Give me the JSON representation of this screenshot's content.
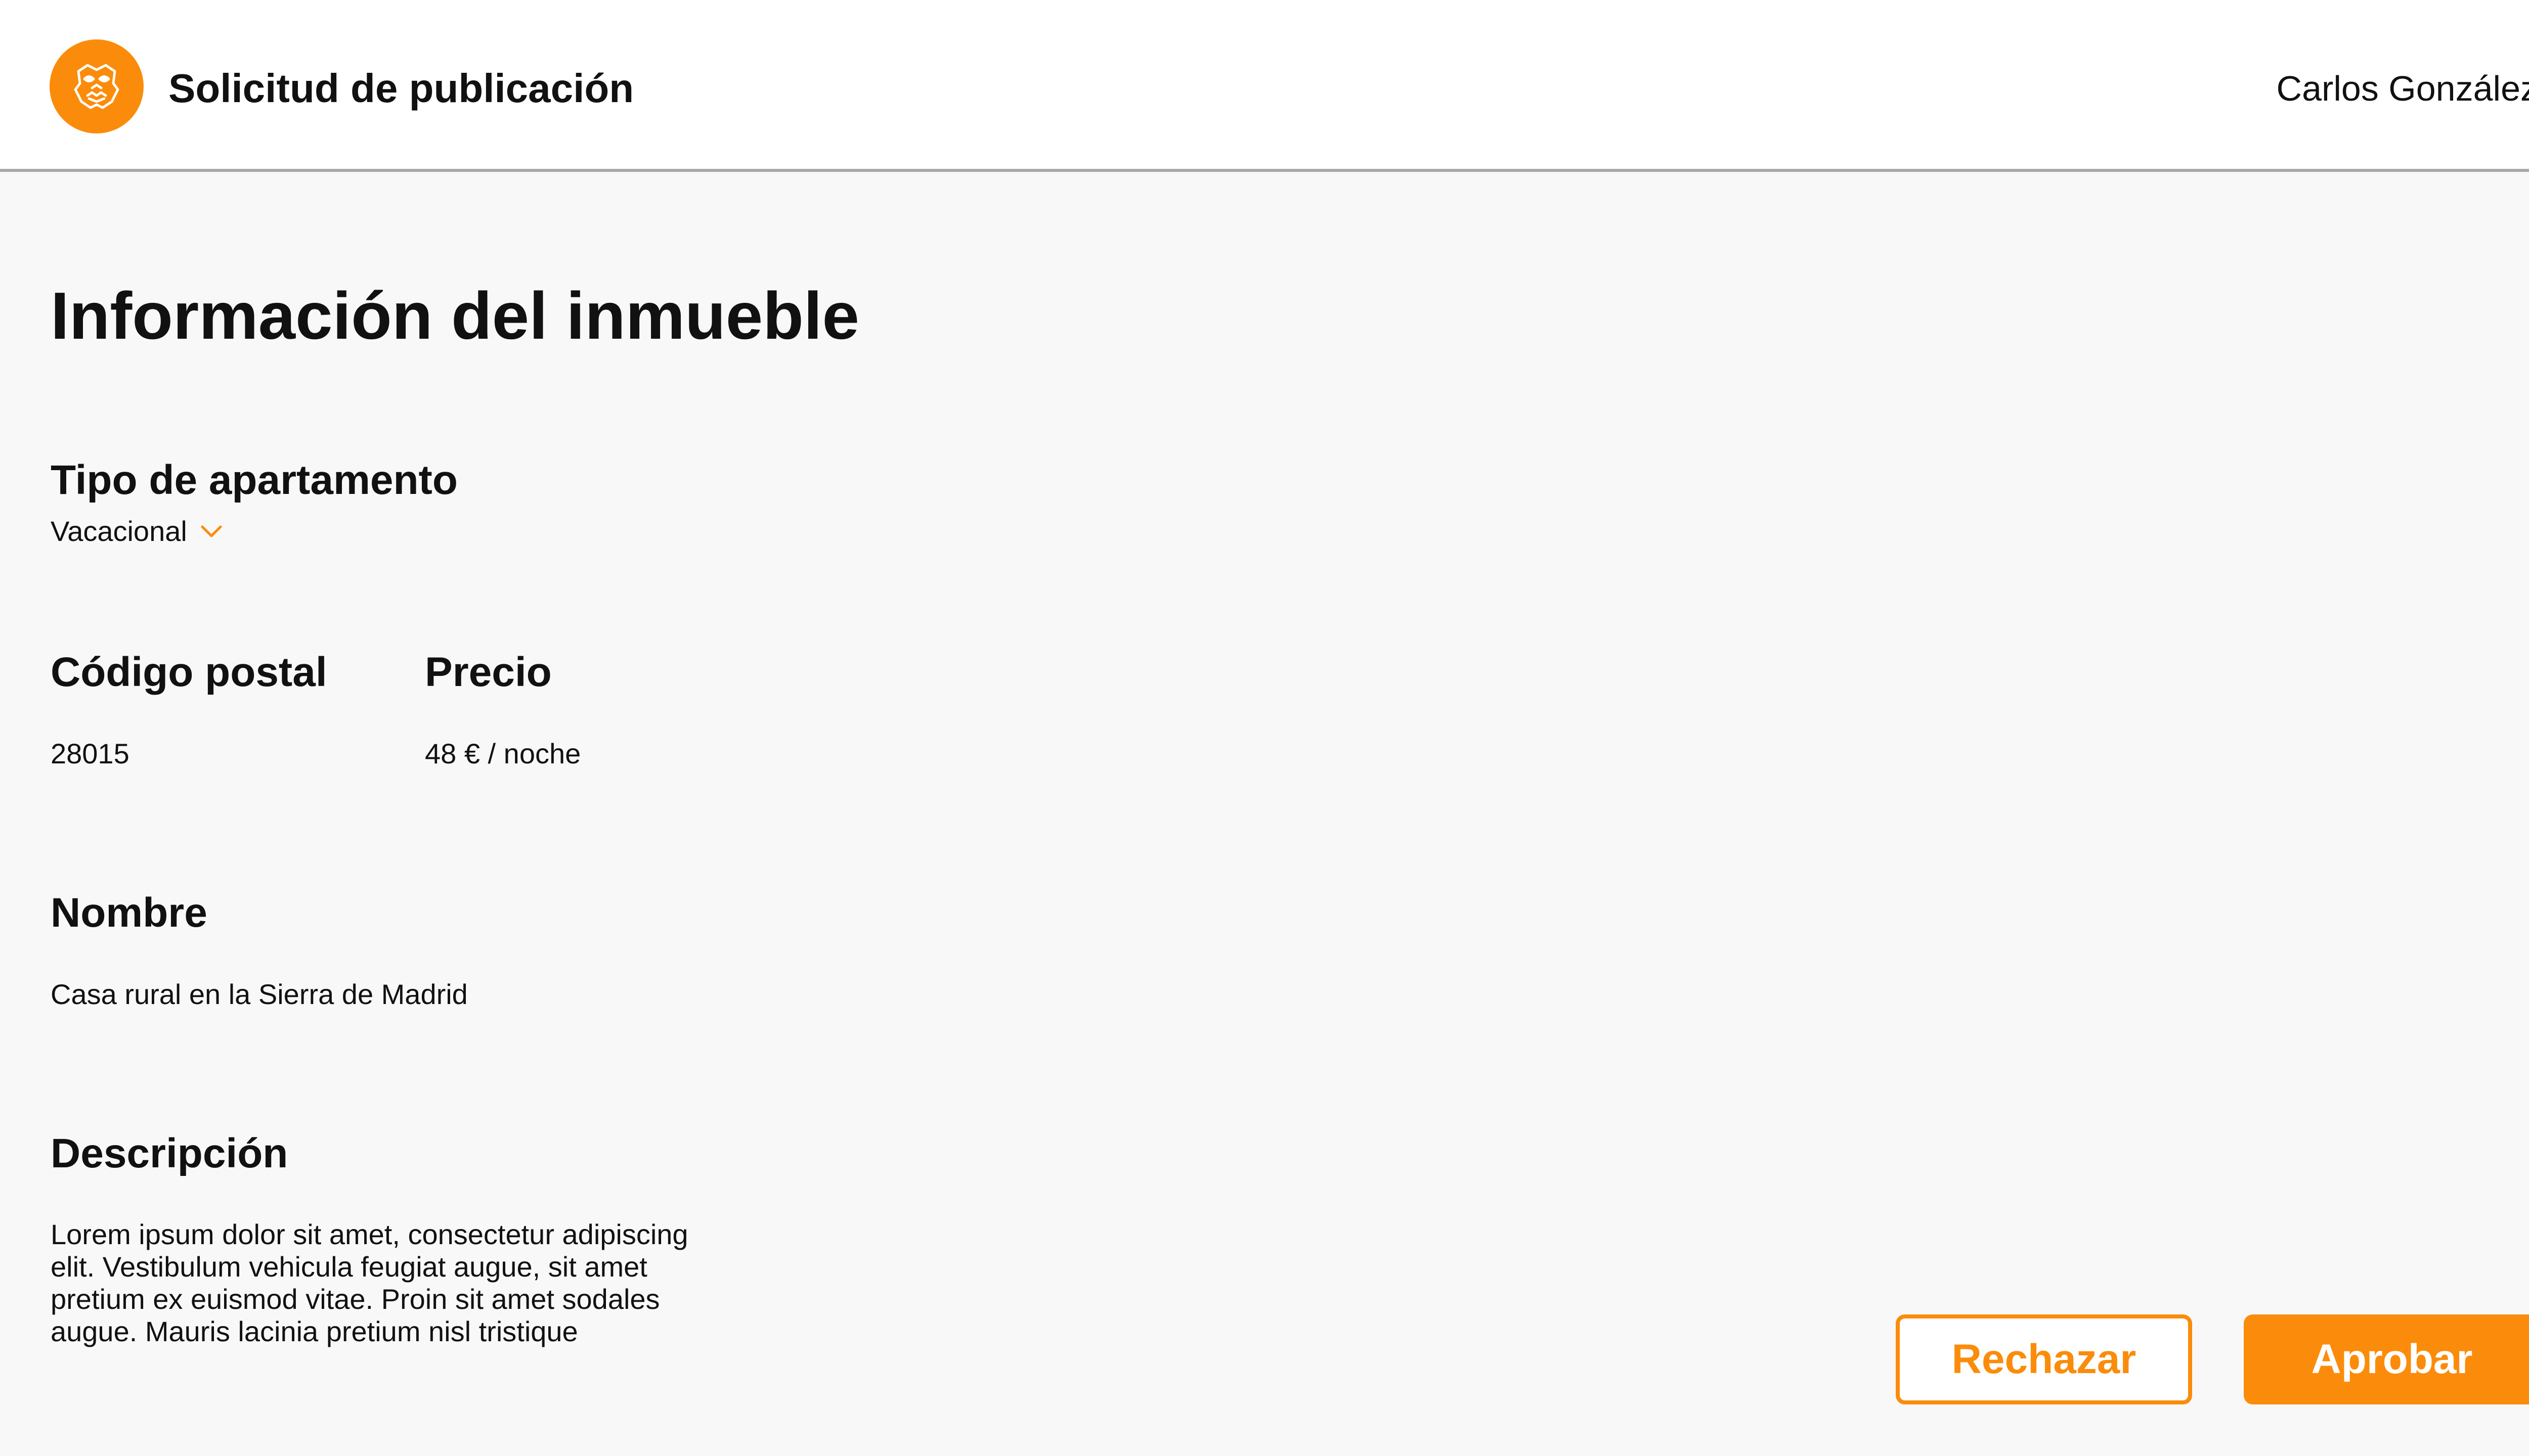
{
  "header": {
    "title": "Solicitud de publicación",
    "user_name": "Carlos González",
    "logo_icon": "mask-face-icon",
    "brand_color": "#fb8c0b"
  },
  "main": {
    "section_title": "Información del inmueble",
    "apartment_type": {
      "label": "Tipo de apartamento",
      "value": "Vacacional",
      "icon": "chevron-down-icon"
    },
    "postal_code": {
      "label": "Código postal",
      "value": "28015"
    },
    "price": {
      "label": "Precio",
      "value": "48 € / noche"
    },
    "name": {
      "label": "Nombre",
      "value": "Casa rural en la Sierra de Madrid"
    },
    "description": {
      "label": "Descripción",
      "value": "Lorem ipsum dolor sit amet, consectetur adipiscing elit. Vestibulum vehicula feugiat augue, sit amet pretium ex euismod vitae. Proin sit amet sodales augue. Mauris lacinia pretium nisl tristique"
    }
  },
  "actions": {
    "reject_label": "Rechazar",
    "approve_label": "Aprobar"
  }
}
